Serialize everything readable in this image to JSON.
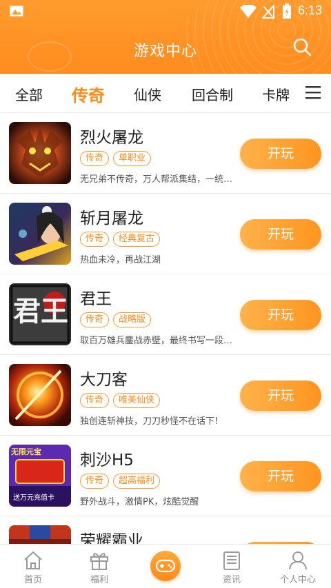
{
  "status_bar": {
    "time": "6:13"
  },
  "header": {
    "title": "游戏中心"
  },
  "tabs": [
    {
      "label": "全部"
    },
    {
      "label": "传奇",
      "active": true
    },
    {
      "label": "仙侠"
    },
    {
      "label": "回合制"
    },
    {
      "label": "卡牌"
    }
  ],
  "games": [
    {
      "name": "烈火屠龙",
      "tags": [
        "传奇",
        "单职业"
      ],
      "desc": "无兄弟不传奇，万人帮派集结，一统…",
      "button": "开玩"
    },
    {
      "name": "斩月屠龙",
      "tags": [
        "传奇",
        "经典复古"
      ],
      "desc": "热血未冷，再战江湖",
      "button": "开玩"
    },
    {
      "name": "君王",
      "tags": [
        "传奇",
        "战略版"
      ],
      "desc": "取百万雄兵鏖战赤壁，最终书写一段…",
      "button": "开玩"
    },
    {
      "name": "大刀客",
      "tags": [
        "传奇",
        "唯美仙侠"
      ],
      "desc": "独创连斩神技，刀刀秒怪不在话下!",
      "button": "开玩"
    },
    {
      "name": "刺沙H5",
      "tags": [
        "传奇",
        "超高福利"
      ],
      "desc": "野外战斗，激情PK，炫酷觉醒",
      "button": "开玩"
    },
    {
      "name": "荣耀霸业",
      "tags": [],
      "desc": "",
      "button": ""
    }
  ],
  "thumbnail_text": {
    "junwang": "君王",
    "cisha_top": "无限元宝",
    "cisha_bottom": "送万元充值卡"
  },
  "bottom_nav": [
    {
      "label": "首页",
      "icon": "home-icon"
    },
    {
      "label": "福利",
      "icon": "gift-icon"
    },
    {
      "label": "",
      "icon": "gamepad-icon"
    },
    {
      "label": "资讯",
      "icon": "news-icon"
    },
    {
      "label": "个人中心",
      "icon": "user-icon"
    }
  ],
  "colors": {
    "accent": "#ff8a1a",
    "header": "#ff9b2e",
    "text": "#222222"
  }
}
